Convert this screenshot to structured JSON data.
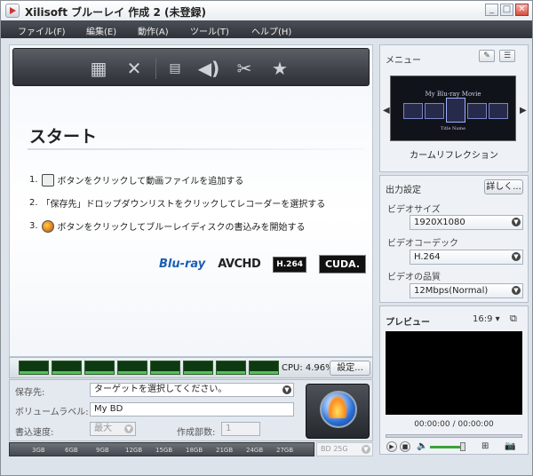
{
  "window": {
    "title": "Xilisoft ブルーレイ 作成 2 (未登録)"
  },
  "menu": [
    "ファイル(F)",
    "編集(E)",
    "動作(A)",
    "ツール(T)",
    "ヘルプ(H)"
  ],
  "toolbar": {
    "icons": [
      "add-video-icon",
      "remove-icon",
      "subtitle-icon",
      "audio-icon",
      "effects-icon",
      "chapter-icon"
    ]
  },
  "start": {
    "title": "スタート",
    "steps": [
      {
        "num": "1.",
        "text": "ボタンをクリックして動画ファイルを追加する"
      },
      {
        "num": "2.",
        "text": "「保存先」ドロップダウンリストをクリックしてレコーダーを選択する"
      },
      {
        "num": "3.",
        "text": "ボタンをクリックしてブルーレイディスクの書込みを開始する"
      }
    ]
  },
  "logos": {
    "bluray": "Blu-ray",
    "avchd": "AVCHD",
    "h264": "H.264",
    "cuda": "CUDA."
  },
  "cpu": {
    "label": "CPU: 4.96%",
    "settings": "設定..."
  },
  "form": {
    "dest_label": "保存先:",
    "dest_value": "ターゲットを選択してください。",
    "volume_label": "ボリュームラベル:",
    "volume_value": "My BD",
    "speed_label": "書込速度:",
    "speed_value": "最大",
    "copies_label": "作成部数:",
    "copies_value": "1"
  },
  "scale": {
    "ticks": [
      "3GB",
      "6GB",
      "9GB",
      "12GB",
      "15GB",
      "18GB",
      "21GB",
      "24GB",
      "27GB"
    ],
    "disc": "BD 25G"
  },
  "menu_panel": {
    "label": "メニュー",
    "preview_title": "My Blu-ray Movie",
    "preview_subtitle": "Title Name",
    "name": "カームリフレクション"
  },
  "output": {
    "label": "出力設定",
    "detail": "詳しく...",
    "size_label": "ビデオサイズ",
    "size_value": "1920X1080",
    "codec_label": "ビデオコーデック",
    "codec_value": "H.264",
    "quality_label": "ビデオの品質",
    "quality_value": "12Mbps(Normal)"
  },
  "preview": {
    "label": "プレビュー",
    "ratio": "16:9",
    "time": "00:00:00 / 00:00:00"
  }
}
